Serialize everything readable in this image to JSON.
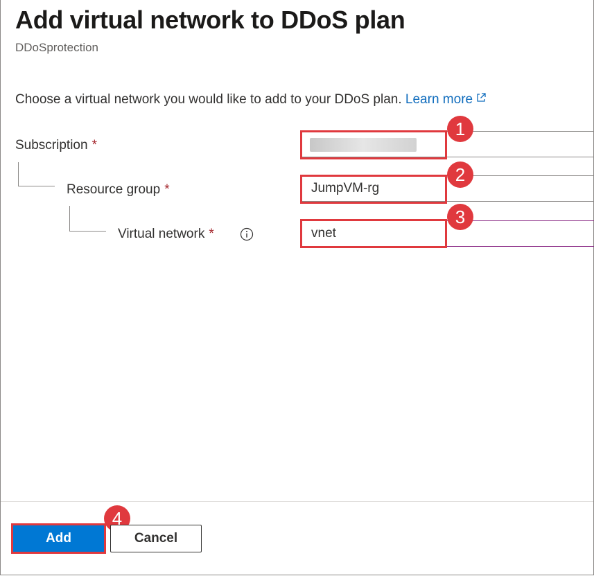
{
  "header": {
    "title": "Add virtual network to DDoS plan",
    "subtitle": "DDoSprotection"
  },
  "description": {
    "text": "Choose a virtual network you would like to add to your DDoS plan.",
    "link_label": "Learn more"
  },
  "form": {
    "subscription": {
      "label": "Subscription",
      "required_mark": "*",
      "value": ""
    },
    "resource_group": {
      "label": "Resource group",
      "required_mark": "*",
      "value": "JumpVM-rg"
    },
    "virtual_network": {
      "label": "Virtual network",
      "required_mark": "*",
      "value": "vnet"
    }
  },
  "annotations": {
    "step1": "1",
    "step2": "2",
    "step3": "3",
    "step4": "4",
    "highlight_color": "#e0393e"
  },
  "footer": {
    "add_label": "Add",
    "cancel_label": "Cancel"
  },
  "colors": {
    "primary": "#0078d4",
    "link": "#0f6cbd",
    "required": "#a4262c",
    "focus_border": "#8a2a86"
  },
  "icons": {
    "external_link": "external-link-icon",
    "info": "info-icon"
  }
}
